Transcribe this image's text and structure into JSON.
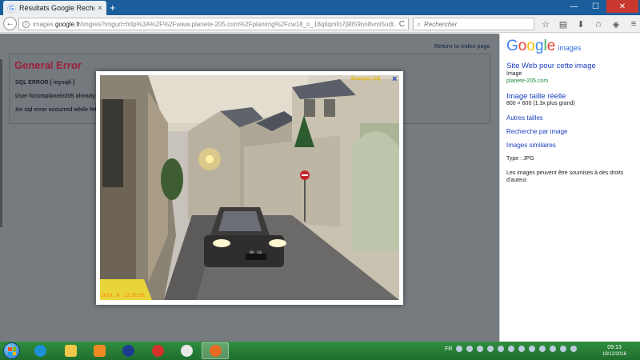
{
  "browser": {
    "tab_title": "Résultats Google Recherch...",
    "tab_close": "×",
    "new_tab": "+",
    "url_prefix": "images.",
    "url_domain": "google.fr",
    "url_rest": "/imgres?imgurl=http%3A%2F%2Fwww.planete-205.com%2Fplanimg%2Fcw18_o_18qltqmfo7j9lt59nn8vmi5udt.JPG&imgre",
    "search_placeholder": "Rechercher",
    "back_glyph": "←",
    "reload_glyph": "C"
  },
  "page": {
    "return_link": "Return to index page",
    "error_title": "General Error",
    "error_lines": [
      "SQL ERROR [ mysqli ]",
      "User forumplanete205 already",
      "An sql error occurred while fet"
    ]
  },
  "lightbox": {
    "close_label": "×",
    "caption": "Bourges (18)",
    "timestamp": "2014 . 8 . 12 22:05",
    "plate": "OF 18"
  },
  "panel": {
    "logo": [
      "G",
      "o",
      "o",
      "g",
      "l",
      "e"
    ],
    "logo_colors": [
      "#4285f4",
      "#ea4335",
      "#fbbc05",
      "#4285f4",
      "#34a853",
      "#ea4335"
    ],
    "images_link": "images",
    "site_link": "Site Web pour cette image",
    "image_label": "Image",
    "site_domain": "planete-205.com",
    "full_size_link": "Image taille réelle",
    "dimensions": "800 × 600 (1.3x plus grand)",
    "other_sizes": "Autres tailles",
    "search_by_image": "Recherche par image",
    "similar_images": "Images similaires",
    "type_label": "Type : JPG",
    "copyright_note_1": "Les images peuvent être soumises à des droits",
    "copyright_note_2": "d'auteur."
  },
  "taskbar": {
    "lang": "FR",
    "time": "09:13",
    "date": "19/12/2016"
  },
  "colors": {
    "accent_link": "#1a3fbf",
    "error_title": "#9d1e3f",
    "taskbar": "#2f8f3f",
    "tab_bar": "#1b5e9c"
  }
}
